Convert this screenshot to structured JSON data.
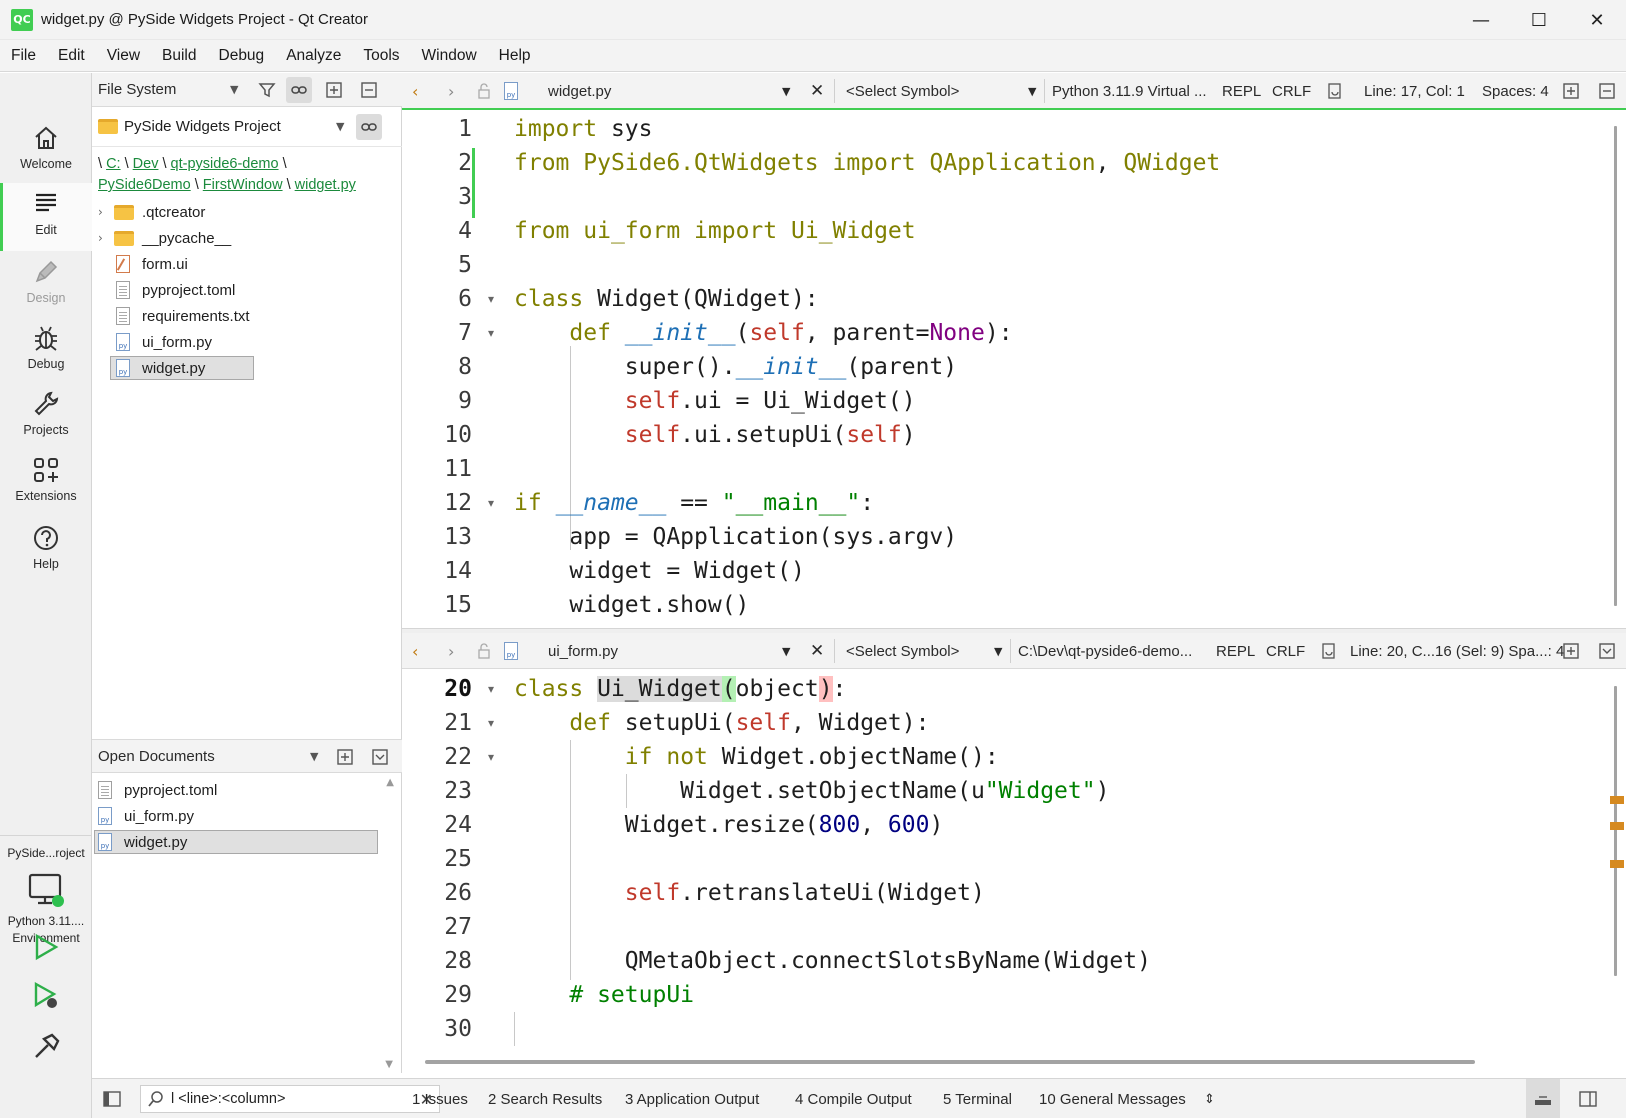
{
  "window": {
    "logo": "QC",
    "title": "widget.py @ PySide Widgets Project - Qt Creator",
    "minimize": "—",
    "maximize": "☐",
    "close": "✕"
  },
  "menubar": [
    "File",
    "Edit",
    "View",
    "Build",
    "Debug",
    "Analyze",
    "Tools",
    "Window",
    "Help"
  ],
  "modes": [
    {
      "label": "Welcome",
      "icon": "home-icon"
    },
    {
      "label": "Edit",
      "icon": "edit-lines-icon"
    },
    {
      "label": "Design",
      "icon": "pen-icon"
    },
    {
      "label": "Debug",
      "icon": "bug-icon"
    },
    {
      "label": "Projects",
      "icon": "wrench-icon"
    },
    {
      "label": "Extensions",
      "icon": "extensions-grid-icon"
    },
    {
      "label": "Help",
      "icon": "help-circle-icon"
    }
  ],
  "kit": {
    "project": "PySide...roject",
    "env_line1": "Python 3.11....",
    "env_line2": "Environment"
  },
  "navigator": {
    "view": "File System",
    "project": "PySide Widgets Project",
    "breadcrumb": [
      "C:",
      "Dev",
      "qt-pyside6-demo",
      "PySide6Demo",
      "FirstWindow",
      "widget.py"
    ],
    "breadcrumb_sep": "\\",
    "tree": [
      {
        "name": ".qtcreator",
        "type": "folder",
        "expandable": true
      },
      {
        "name": "__pycache__",
        "type": "folder",
        "expandable": true
      },
      {
        "name": "form.ui",
        "type": "ui"
      },
      {
        "name": "pyproject.toml",
        "type": "text"
      },
      {
        "name": "requirements.txt",
        "type": "text"
      },
      {
        "name": "ui_form.py",
        "type": "py"
      },
      {
        "name": "widget.py",
        "type": "py",
        "selected": true
      }
    ]
  },
  "open_documents": {
    "title": "Open Documents",
    "items": [
      {
        "name": "pyproject.toml",
        "type": "text"
      },
      {
        "name": "ui_form.py",
        "type": "py"
      },
      {
        "name": "widget.py",
        "type": "py",
        "selected": true
      }
    ]
  },
  "editor_top": {
    "file": "widget.py",
    "symbol": "<Select Symbol>",
    "interpreter": "Python 3.11.9 Virtual ...",
    "repl": "REPL",
    "line_ending": "CRLF",
    "position": "Line: 17, Col: 1",
    "indent": "Spaces: 4"
  },
  "editor_bottom": {
    "file": "ui_form.py",
    "symbol": "<Select Symbol>",
    "interpreter": "C:\\Dev\\qt-pyside6-demo...",
    "repl": "REPL",
    "line_ending": "CRLF",
    "position": "Line: 20, C...16 (Sel: 9) Spa...: 4"
  },
  "code_top_numbers": [
    "1",
    "2",
    "3",
    "4",
    "5",
    "6",
    "7",
    "8",
    "9",
    "10",
    "11",
    "12",
    "13",
    "14",
    "15"
  ],
  "code_bottom_numbers": [
    "20",
    "21",
    "22",
    "23",
    "24",
    "25",
    "26",
    "27",
    "28",
    "29",
    "30"
  ],
  "statusbar": {
    "locator_placeholder": "l <line>:<column>",
    "panes": [
      "1  Issues",
      "2  Search Results",
      "3  Application Output",
      "4  Compile Output",
      "5  Terminal",
      "10  General Messages"
    ]
  },
  "colors": {
    "accent": "#41cd52",
    "keyword": "#808000",
    "self": "#c0392b",
    "string": "#008000",
    "number": "#000080",
    "dunder": "#1d6fb5"
  }
}
